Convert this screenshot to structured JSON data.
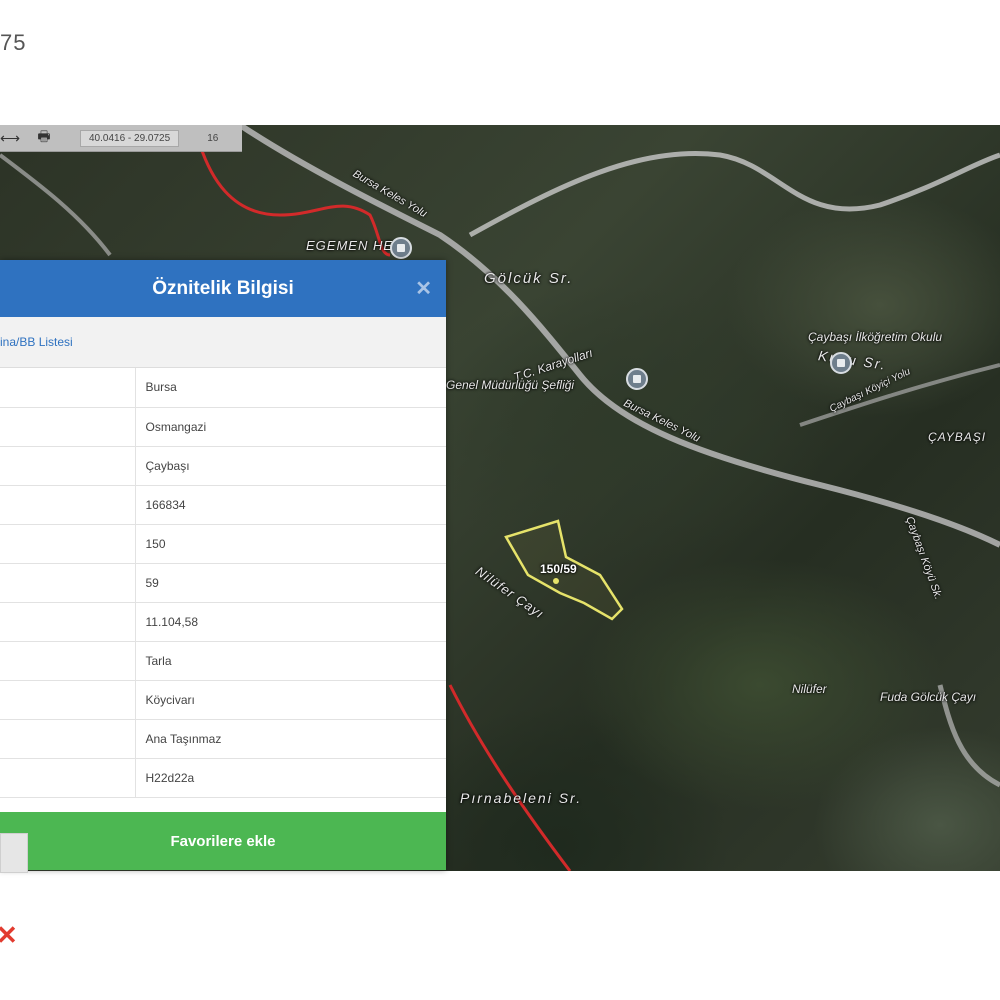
{
  "page_id_text": "75",
  "toolbar": {
    "measure_icon": "ruler-icon",
    "print_icon": "printer-icon",
    "coords": "40.0416 - 29.0725",
    "zoom": "16"
  },
  "map": {
    "labels": {
      "golcuk": "Gölcük Sr.",
      "kuyu": "Kuyu Sr.",
      "egemen": "EGEMEN HES",
      "caybasi_okul": "Çaybaşı İlköğretim Okulu",
      "tc_karayollari": "T.C. Karayolları",
      "genel_mudurlugu": "Genel Müdürlüğü Şefliği",
      "bursa_keles_1": "Bursa Keles Yolu",
      "bursa_keles_2": "Bursa Keles Yolu",
      "caybasi_koyici": "Çaybaşı Köyiçi Yolu",
      "caybasi": "ÇAYBAŞI",
      "caybasi_koyu2": "Çaybaşı Köyü Sk.",
      "nilufer": "Nilüfer Çayı",
      "nilufer2": "Nilüfer",
      "fuda": "Fuda Gölcük Çayı",
      "pirnab": "Pırnabeleni Sr.",
      "parcel": "150/59"
    },
    "colors": {
      "parcel_outline": "#e6e36a",
      "boundary_line": "#d22a2a",
      "road": "#b9b9b9"
    }
  },
  "panel": {
    "title": "Öznitelik Bilgisi",
    "close_icon": "close-icon",
    "subtitle": "ina/BB Listesi",
    "rows": [
      {
        "key": "",
        "value": "Bursa"
      },
      {
        "key": "",
        "value": "Osmangazi"
      },
      {
        "key": "",
        "value": "Çaybaşı"
      },
      {
        "key": "",
        "value": "166834"
      },
      {
        "key": "",
        "value": "150"
      },
      {
        "key": "",
        "value": "59"
      },
      {
        "key": "",
        "value": "11.104,58"
      },
      {
        "key": "",
        "value": "Tarla"
      },
      {
        "key": "",
        "value": "Köycivarı"
      },
      {
        "key": "",
        "value": "Ana Taşınmaz"
      },
      {
        "key": "",
        "value": "H22d22a"
      }
    ],
    "favorite_button": "Favorilere ekle",
    "header_color": "#2f72c0",
    "button_color": "#4cb752"
  },
  "footer": {
    "mark": "✕"
  }
}
